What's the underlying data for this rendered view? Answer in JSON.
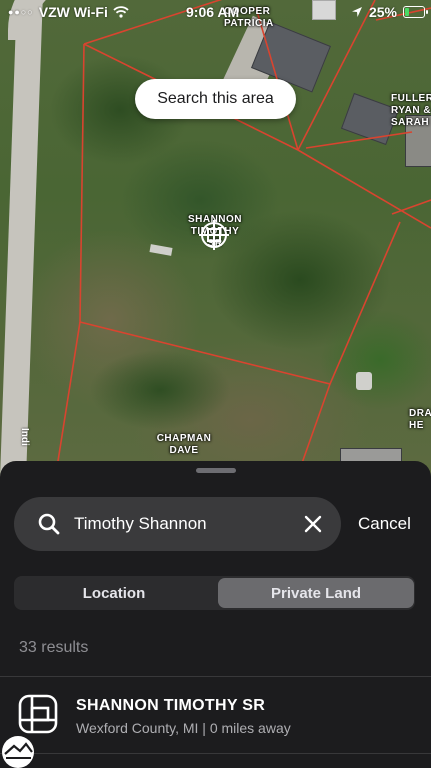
{
  "status_bar": {
    "carrier": "VZW Wi-Fi",
    "time": "9:06 AM",
    "battery": "25%",
    "battery_level": 0.25
  },
  "map": {
    "search_area_button": "Search this area",
    "owner_labels": {
      "cooper": [
        "COOPER",
        "PATRICIA"
      ],
      "fuller": [
        "FULLER",
        "RYAN &",
        "SARAH"
      ],
      "shannon": [
        "SHANNON",
        "TIMOTHY",
        "SR"
      ],
      "chapman": [
        "CHAPMAN",
        "DAVE"
      ],
      "dra": [
        "DRA",
        "HE"
      ]
    },
    "road_label": "Indi",
    "parcel_line_color": "#d9442f"
  },
  "search": {
    "query": "Timothy Shannon",
    "cancel_label": "Cancel"
  },
  "tabs": {
    "location": "Location",
    "private_land": "Private Land",
    "selected": "private_land"
  },
  "results": {
    "count_label": "33 results",
    "items": [
      {
        "title": "SHANNON TIMOTHY SR",
        "subtitle": "Wexford County, MI | 0 miles away"
      }
    ]
  }
}
